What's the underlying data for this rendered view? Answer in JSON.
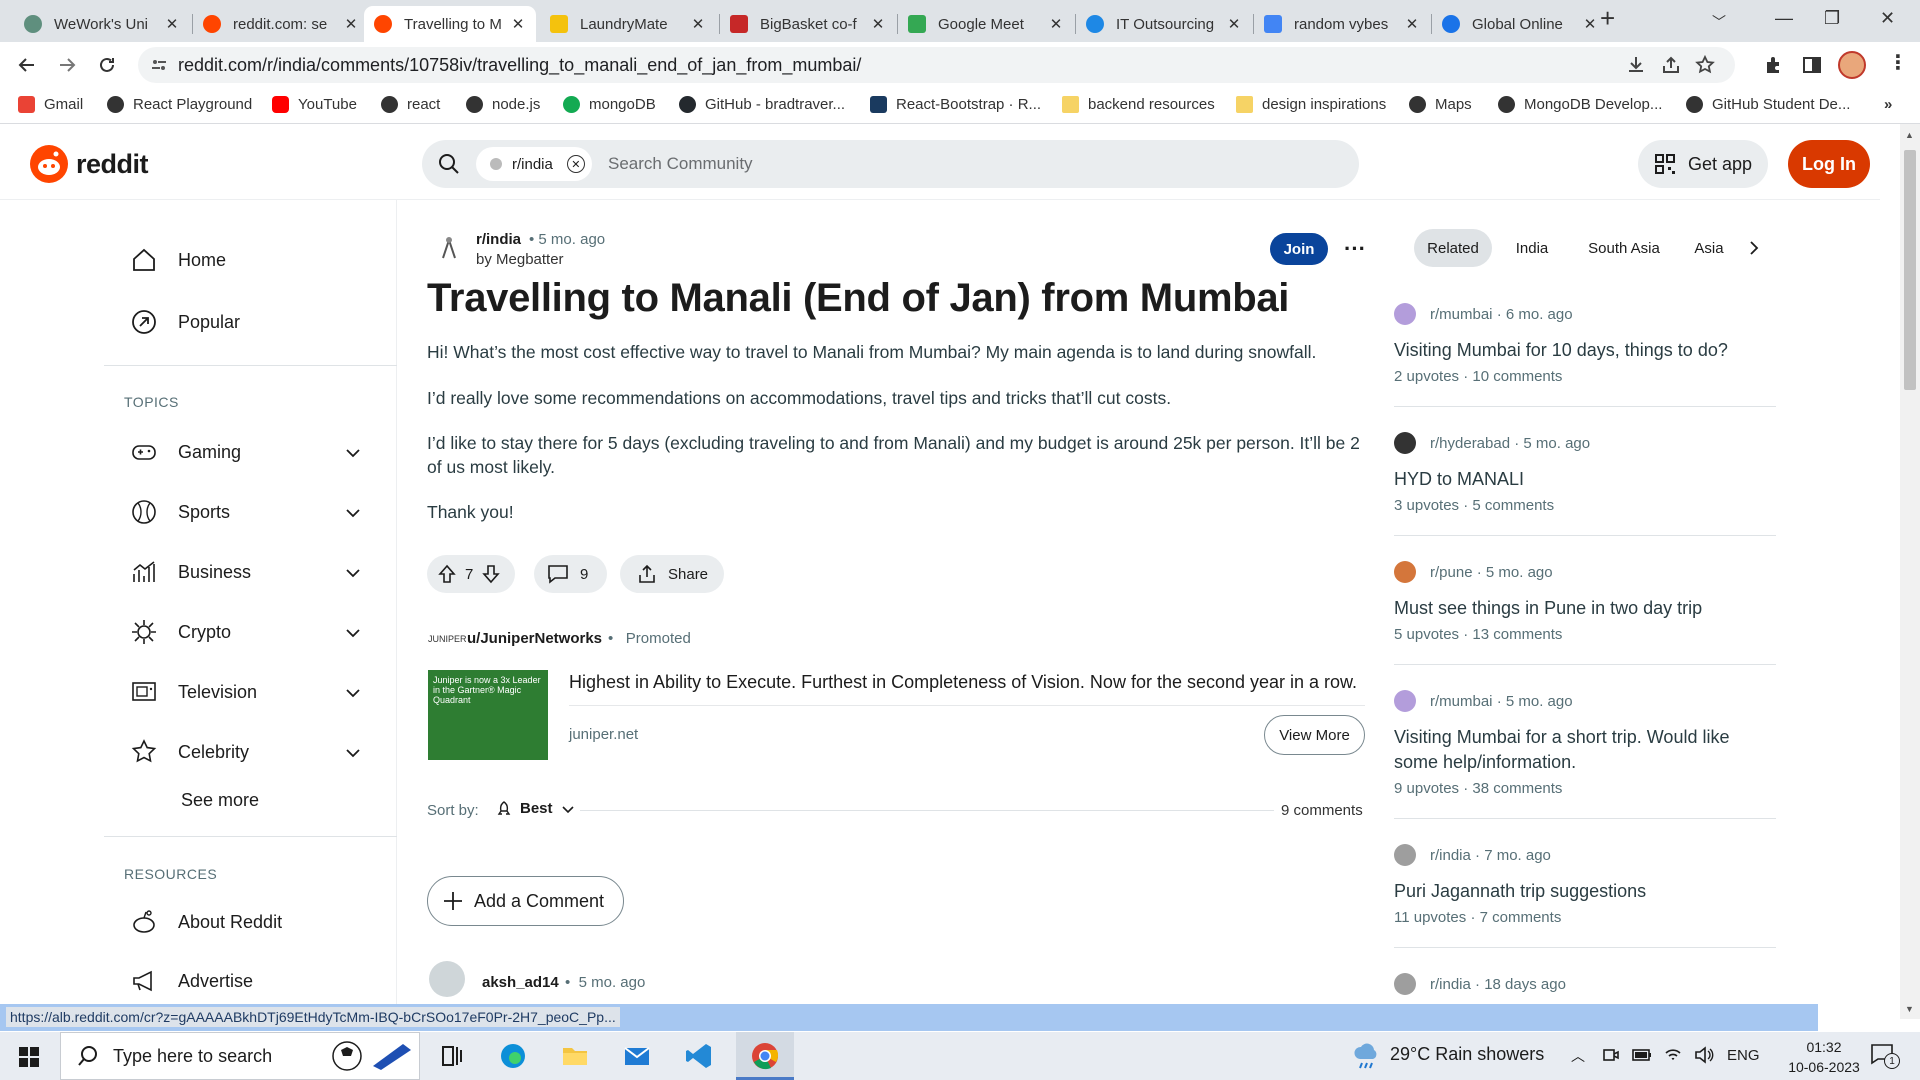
{
  "browser": {
    "tabs": [
      {
        "title": "WeWork's Uni",
        "color": "#5f8f7e"
      },
      {
        "title": "reddit.com: se",
        "color": "#ff4500"
      },
      {
        "title": "Travelling to M",
        "color": "#ff4500"
      },
      {
        "title": "LaundryMate",
        "color": "#f4c20d"
      },
      {
        "title": "BigBasket co-f",
        "color": "#c62828"
      },
      {
        "title": "Google Meet",
        "color": "#34a853"
      },
      {
        "title": "IT Outsourcing",
        "color": "#1e88e5"
      },
      {
        "title": "random vybes",
        "color": "#4285f4"
      },
      {
        "title": "Global Online",
        "color": "#1a73e8"
      }
    ],
    "url": "reddit.com/r/india/comments/10758iv/travelling_to_manali_end_of_jan_from_mumbai/",
    "bookmarks": [
      {
        "label": "Gmail",
        "color": "#ea4335"
      },
      {
        "label": "React Playground",
        "color": "#333333"
      },
      {
        "label": "YouTube",
        "color": "#ff0000"
      },
      {
        "label": "react",
        "color": "#333333"
      },
      {
        "label": "node.js",
        "color": "#333333"
      },
      {
        "label": "mongoDB",
        "color": "#13aa52"
      },
      {
        "label": "GitHub - bradtraver...",
        "color": "#24292e"
      },
      {
        "label": "React-Bootstrap · R...",
        "color": "#1a3a5f"
      },
      {
        "label": "backend resources",
        "color": "#f6d365"
      },
      {
        "label": "design inspirations",
        "color": "#f6d365"
      },
      {
        "label": "Maps",
        "color": "#333333"
      },
      {
        "label": "MongoDB Develop...",
        "color": "#333333"
      },
      {
        "label": "GitHub Student De...",
        "color": "#333333"
      }
    ],
    "status_url": "https://alb.reddit.com/cr?z=gAAAAABkhDTj69EtHdyTcMm-IBQ-bCrSOo17eF0Pr-2H7_peoC_Pp..."
  },
  "header": {
    "logo_text": "reddit",
    "search_chip": "r/india",
    "search_placeholder": "Search Community",
    "get_app": "Get app",
    "login": "Log In"
  },
  "sidebar": {
    "home": "Home",
    "popular": "Popular",
    "topics_label": "TOPICS",
    "topics": [
      "Gaming",
      "Sports",
      "Business",
      "Crypto",
      "Television",
      "Celebrity"
    ],
    "see_more": "See more",
    "resources_label": "RESOURCES",
    "resources": [
      "About Reddit",
      "Advertise"
    ]
  },
  "post": {
    "subreddit": "r/india",
    "age": "• 5 mo. ago",
    "author": "by Megbatter",
    "join": "Join",
    "title": "Travelling to Manali (End of Jan) from Mumbai",
    "body": [
      "Hi! What’s the most cost effective way to travel to Manali from Mumbai? My main agenda is to land during snowfall.",
      "I’d really love some recommendations on accommodations, travel tips and tricks that’ll cut costs.",
      "I’d like to stay there for 5 days (excluding traveling to and from Manali) and my budget is around 25k per person. It’ll be 2 of us most likely.",
      "Thank you!"
    ],
    "votes": "7",
    "comments": "9",
    "share": "Share"
  },
  "promoted": {
    "brand_mark": "JUNIPER",
    "user": "u/JuniperNetworks",
    "label": "Promoted",
    "image_text": "Juniper is now a 3x Leader in the Gartner® Magic Quadrant",
    "headline": "Highest in Ability to Execute. Furthest in Completeness of Vision. Now for the second year in a row.",
    "domain": "juniper.net",
    "cta": "View More"
  },
  "comments_section": {
    "sort_label": "Sort by:",
    "sort_value": "Best",
    "count": "9 comments",
    "add_comment": "Add a Comment",
    "first_comment_user": "aksh_ad14",
    "first_comment_age": "5 mo. ago"
  },
  "right_sidebar": {
    "tabs": [
      "Related",
      "India",
      "South Asia",
      "Asia"
    ],
    "related": [
      {
        "sub": "r/mumbai",
        "age": "· 6 mo. ago",
        "title": "Visiting Mumbai for 10 days, things to do?",
        "upvotes": "2 upvotes",
        "comments": "10 comments",
        "color": "#b39ddb"
      },
      {
        "sub": "r/hyderabad",
        "age": "· 5 mo. ago",
        "title": "HYD to MANALI",
        "upvotes": "3 upvotes",
        "comments": "5 comments",
        "color": "#333333"
      },
      {
        "sub": "r/pune",
        "age": "· 5 mo. ago",
        "title": "Must see things in Pune in two day trip",
        "upvotes": "5 upvotes",
        "comments": "13 comments",
        "color": "#d4763b"
      },
      {
        "sub": "r/mumbai",
        "age": "· 5 mo. ago",
        "title": "Visiting Mumbai for a short trip. Would like some help/information.",
        "upvotes": "9 upvotes",
        "comments": "38 comments",
        "color": "#b39ddb"
      },
      {
        "sub": "r/india",
        "age": "· 7 mo. ago",
        "title": "Puri Jagannath trip suggestions",
        "upvotes": "11 upvotes",
        "comments": "7 comments",
        "color": "#9e9e9e"
      },
      {
        "sub": "r/india",
        "age": "· 18 days ago",
        "title": "",
        "upvotes": "",
        "comments": "",
        "color": "#9e9e9e"
      }
    ]
  },
  "taskbar": {
    "search_placeholder": "Type here to search",
    "weather": "29°C  Rain showers",
    "lang": "ENG",
    "time": "01:32",
    "date": "10-06-2023",
    "notifications": "1"
  }
}
